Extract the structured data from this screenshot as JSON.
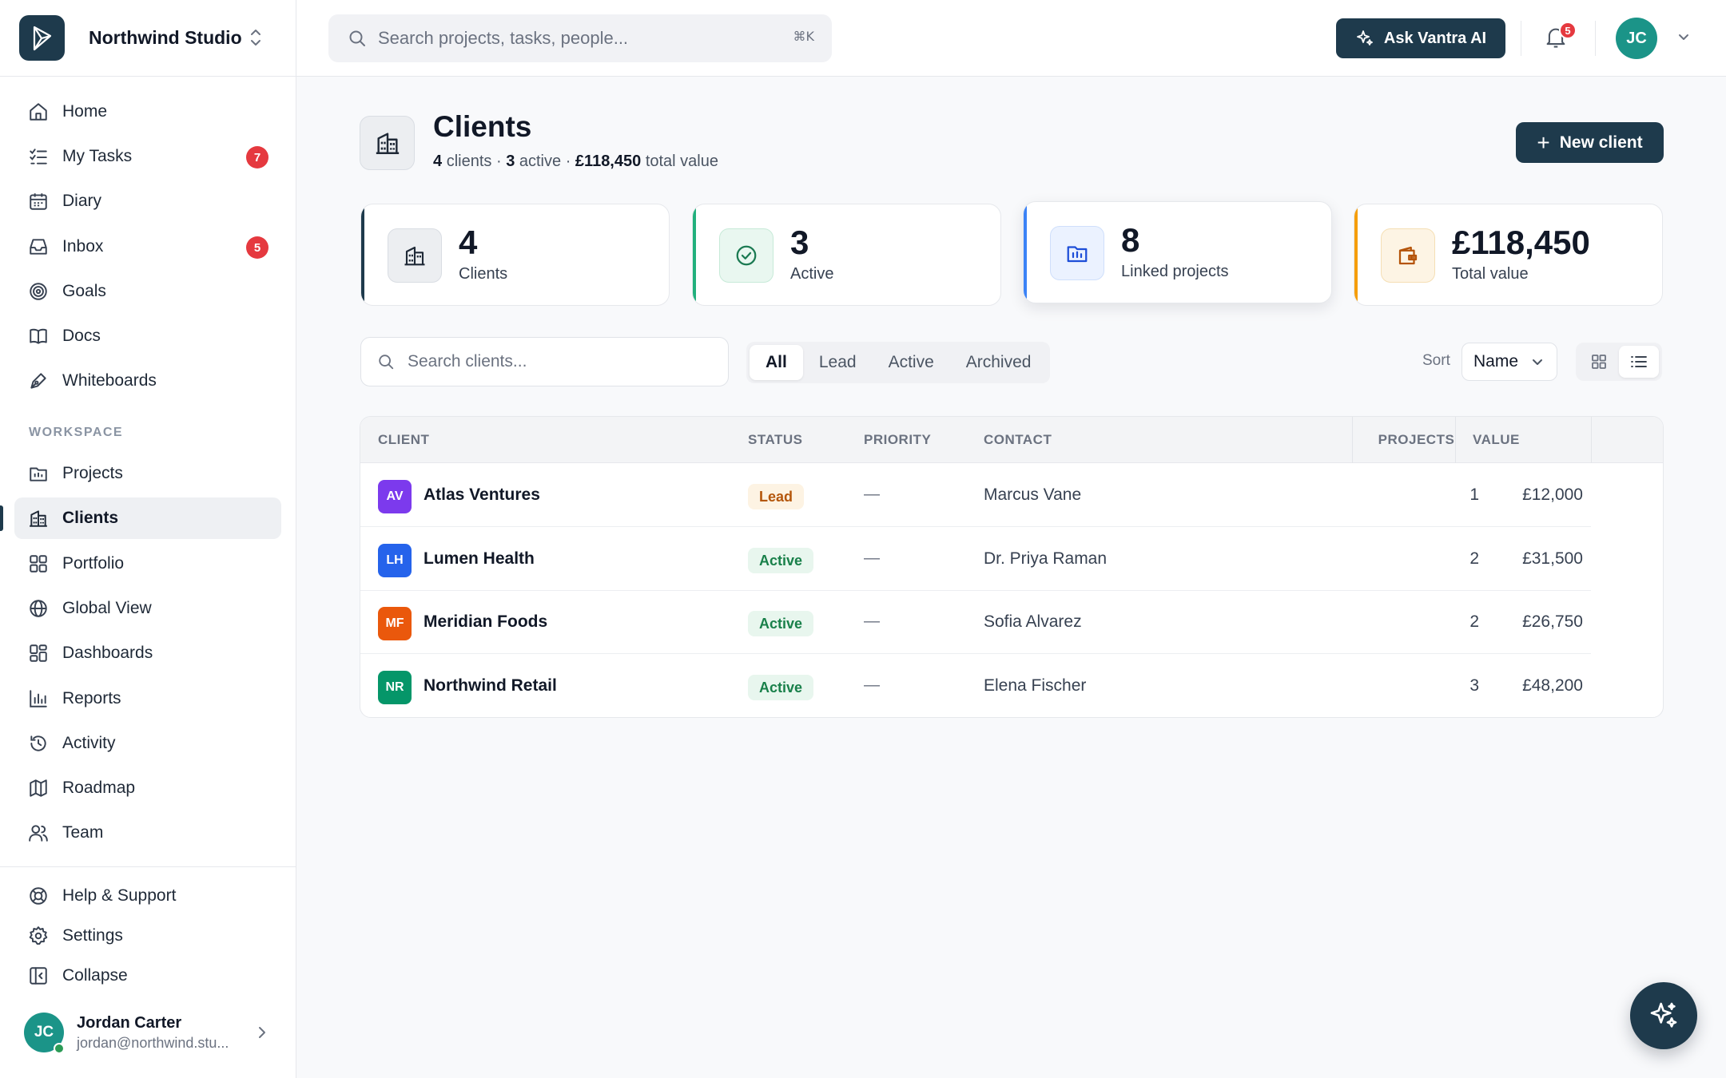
{
  "workspace": {
    "name": "Northwind Studio"
  },
  "sidebar": {
    "main_items": [
      {
        "label": "Home",
        "icon": "home-icon"
      },
      {
        "label": "My Tasks",
        "icon": "tasks-icon",
        "badge": "7"
      },
      {
        "label": "Diary",
        "icon": "calendar-icon"
      },
      {
        "label": "Inbox",
        "icon": "inbox-icon",
        "badge": "5"
      },
      {
        "label": "Goals",
        "icon": "target-icon"
      },
      {
        "label": "Docs",
        "icon": "book-icon"
      },
      {
        "label": "Whiteboards",
        "icon": "pen-icon"
      }
    ],
    "section_label": "WORKSPACE",
    "workspace_items": [
      {
        "label": "Projects",
        "icon": "projects-icon"
      },
      {
        "label": "Clients",
        "icon": "building-icon",
        "active": true
      },
      {
        "label": "Portfolio",
        "icon": "grid-icon"
      },
      {
        "label": "Global View",
        "icon": "globe-icon"
      },
      {
        "label": "Dashboards",
        "icon": "dashboard-icon"
      },
      {
        "label": "Reports",
        "icon": "bar-chart-icon"
      },
      {
        "label": "Activity",
        "icon": "history-icon"
      },
      {
        "label": "Roadmap",
        "icon": "map-icon"
      },
      {
        "label": "Team",
        "icon": "users-icon"
      }
    ],
    "bottom_items": [
      {
        "label": "Help & Support",
        "icon": "lifebuoy-icon"
      },
      {
        "label": "Settings",
        "icon": "gear-icon"
      },
      {
        "label": "Collapse",
        "icon": "collapse-icon"
      }
    ],
    "user": {
      "initials": "JC",
      "name": "Jordan Carter",
      "email": "jordan@northwind.stu..."
    }
  },
  "topbar": {
    "search_placeholder": "Search projects, tasks, people...",
    "search_shortcut": "⌘K",
    "ai_button": "Ask Vantra AI",
    "notification_count": "5",
    "avatar_initials": "JC"
  },
  "page": {
    "title": "Clients",
    "summary": {
      "clients_count": "4",
      "clients_word": "clients",
      "active_count": "3",
      "active_word": "active",
      "total_value": "£118,450",
      "value_word": "total value",
      "separator": "·"
    },
    "new_button": "New client"
  },
  "stats": [
    {
      "value": "4",
      "label": "Clients",
      "icon": "building-icon",
      "accent": "#1e3a4c"
    },
    {
      "value": "3",
      "label": "Active",
      "icon": "check-circle-icon",
      "accent": "#22b07d"
    },
    {
      "value": "8",
      "label": "Linked projects",
      "icon": "folder-icon",
      "accent": "#3b82f6"
    },
    {
      "value": "£118,450",
      "label": "Total value",
      "icon": "wallet-icon",
      "accent": "#f59e0b"
    }
  ],
  "toolbar": {
    "search_placeholder": "Search clients...",
    "filters": [
      "All",
      "Lead",
      "Active",
      "Archived"
    ],
    "active_filter": "All",
    "sort_label": "Sort",
    "sort_value": "Name",
    "view_modes": [
      "grid",
      "list"
    ],
    "active_view": "list"
  },
  "table": {
    "headers": [
      "CLIENT",
      "STATUS",
      "PRIORITY",
      "CONTACT",
      "PROJECTS",
      "VALUE"
    ],
    "rows": [
      {
        "initials": "AV",
        "color": "#7c3aed",
        "name": "Atlas Ventures",
        "status": "Lead",
        "priority": "—",
        "contact": "Marcus Vane",
        "projects": "1",
        "value": "£12,000"
      },
      {
        "initials": "LH",
        "color": "#2563eb",
        "name": "Lumen Health",
        "status": "Active",
        "priority": "—",
        "contact": "Dr. Priya Raman",
        "projects": "2",
        "value": "£31,500"
      },
      {
        "initials": "MF",
        "color": "#ea580c",
        "name": "Meridian Foods",
        "status": "Active",
        "priority": "—",
        "contact": "Sofia Alvarez",
        "projects": "2",
        "value": "£26,750"
      },
      {
        "initials": "NR",
        "color": "#059669",
        "name": "Northwind Retail",
        "status": "Active",
        "priority": "—",
        "contact": "Elena Fischer",
        "projects": "3",
        "value": "£48,200"
      }
    ]
  },
  "colors": {
    "brand": "#1e3a4c",
    "badge": "#e5393f",
    "avatar": "#1b9488"
  }
}
